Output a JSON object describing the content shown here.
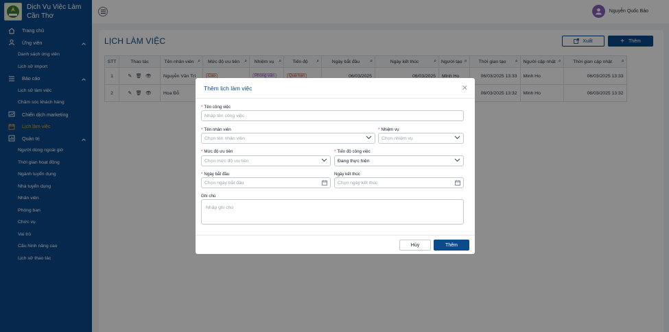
{
  "brand": {
    "name_line1": "Dịch Vụ Việc Làm",
    "name_line2": "Cần Thơ",
    "logo_icon": "org-logo"
  },
  "sidebar": {
    "items": [
      {
        "type": "item",
        "label": "Trang chủ",
        "icon": "home-icon"
      },
      {
        "type": "item",
        "label": "Ứng viên",
        "icon": "user-icon",
        "expanded": true
      },
      {
        "type": "sub",
        "label": "Danh sách ứng viên"
      },
      {
        "type": "sub",
        "label": "Lịch sử import"
      },
      {
        "type": "item",
        "label": "Báo cáo",
        "icon": "list-icon",
        "expanded": true
      },
      {
        "type": "sub",
        "label": "Lịch sử làm việc"
      },
      {
        "type": "sub",
        "label": "Chăm sóc khách hàng"
      },
      {
        "type": "item",
        "label": "Chiến dịch marketing",
        "icon": "chart-icon"
      },
      {
        "type": "item",
        "label": "Lịch làm việc",
        "icon": "calendar-icon",
        "active": true
      },
      {
        "type": "item",
        "label": "Quản trị",
        "icon": "admin-icon",
        "expanded": true
      },
      {
        "type": "sub",
        "label": "Người dùng ngoài giờ"
      },
      {
        "type": "sub",
        "label": "Thời gian hoạt động"
      },
      {
        "type": "sub",
        "label": "Ngành tuyển dụng"
      },
      {
        "type": "sub",
        "label": "Nhà tuyển dụng"
      },
      {
        "type": "sub",
        "label": "Nhân viên"
      },
      {
        "type": "sub",
        "label": "Phòng ban"
      },
      {
        "type": "sub",
        "label": "Chức vụ"
      },
      {
        "type": "sub",
        "label": "Vai trò"
      },
      {
        "type": "sub",
        "label": "Cấu hình nâng cao"
      },
      {
        "type": "sub",
        "label": "Lịch sử thao tác"
      }
    ]
  },
  "topbar": {
    "user_name": "Nguyễn Quốc Bảo"
  },
  "page": {
    "title": "LỊCH LÀM VIỆC",
    "export_label": "Xuất",
    "add_label": "Thêm"
  },
  "table": {
    "columns": [
      "STT",
      "Thao tác",
      "Tên nhân viên",
      "Mức độ ưu tiên",
      "Nhiệm vụ",
      "Tiến độ",
      "Ngày bắt đầu",
      "Ngày kết thúc",
      "Người tạo",
      "Thời gian tạo",
      "Người cập nhật",
      "Thời gian cập nhật"
    ],
    "rows": [
      [
        "1",
        "",
        "Nguyễn Văn Trí",
        "Cao",
        "Phòng vấn",
        "Quá hạn",
        "06/03/2025",
        "06/03/2025",
        "Minh Ho",
        "06/03/2025 13:33",
        "Minh Ho",
        "06/03/2025 13:33"
      ],
      [
        "2",
        "",
        "Hoa Đỗ",
        "",
        "",
        "",
        "",
        "",
        "",
        "06/03/2025 13:32",
        "Minh Ho",
        "06/03/2025 13:32"
      ]
    ]
  },
  "modal": {
    "title": "Thêm lịch làm việc",
    "fields": {
      "job_name": {
        "label": "Tên công việc",
        "placeholder": "Nhập tên công việc"
      },
      "employee": {
        "label": "Tên nhân viên",
        "placeholder": "Chọn tên nhân viên"
      },
      "task": {
        "label": "Nhiệm vụ",
        "placeholder": "Chọn nhiệm vụ"
      },
      "priority": {
        "label": "Mức độ ưu tiên",
        "placeholder": "Chọn mức độ ưu tiên"
      },
      "progress": {
        "label": "Tiến độ công việc",
        "value": "Đang thực hiện"
      },
      "start_date": {
        "label": "Ngày bắt đầu",
        "placeholder": "Chọn ngày bắt đầu"
      },
      "end_date": {
        "label": "Ngày kết thúc",
        "placeholder": "Chọn ngày kết thúc"
      },
      "notes": {
        "label": "Ghi chú",
        "placeholder": "Nhập ghi chú"
      }
    },
    "cancel_label": "Hủy",
    "submit_label": "Thêm"
  },
  "colors": {
    "primary": "#0b4a8b",
    "accent": "#f5a524",
    "danger": "#e11d48"
  }
}
